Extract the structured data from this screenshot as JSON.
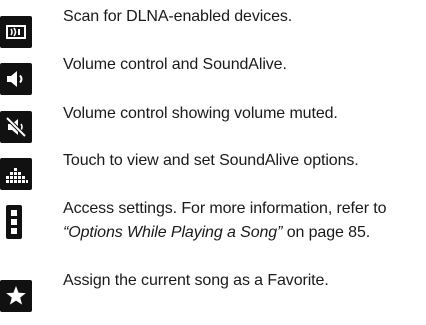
{
  "items": [
    {
      "icon": "dlna-scan-icon",
      "text": "Scan for DLNA-enabled devices."
    },
    {
      "icon": "volume-icon",
      "text": "Volume control and SoundAlive."
    },
    {
      "icon": "volume-muted-icon",
      "text": "Volume control showing volume muted."
    },
    {
      "icon": "soundalive-equalizer-icon",
      "text": "Touch to view and set SoundAlive options."
    },
    {
      "icon": "menu-more-icon",
      "line1": "Access settings. For more information, refer to",
      "line2_link": "“Options While Playing a Song”",
      "line2_rest": " on page 85."
    },
    {
      "icon": "star-icon",
      "text": "Assign the current song as a Favorite."
    }
  ],
  "colors": {
    "icon_background": "#111111",
    "icon_foreground": "#ffffff",
    "text": "#1a1a1a"
  }
}
